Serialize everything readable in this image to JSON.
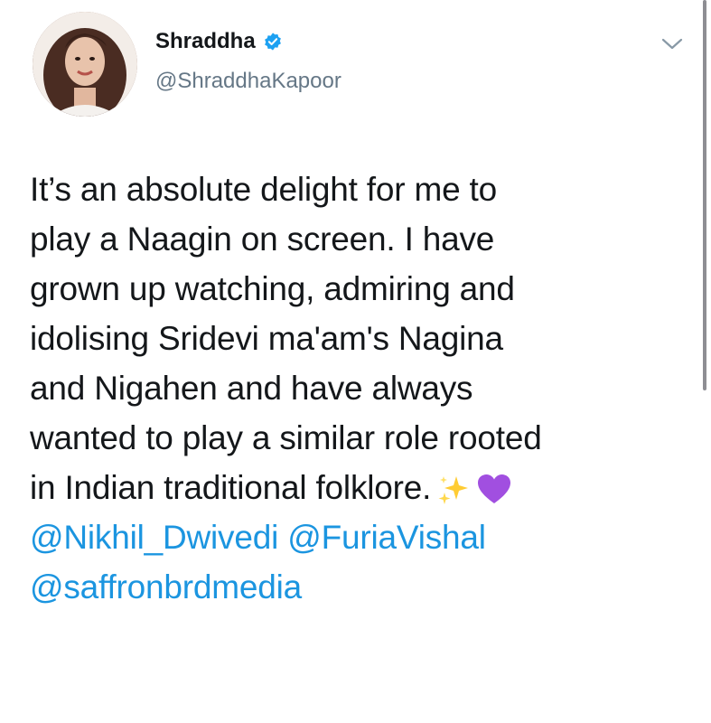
{
  "user": {
    "name": "Shraddha",
    "handle": "@ShraddhaKapoor",
    "verified": true
  },
  "tweet": {
    "lines": [
      "It’s an absolute delight for me to",
      "play a Naagin on screen. I have",
      "grown up watching, admiring and",
      "idolising Sridevi ma'am's Nagina",
      "and Nigahen and have always",
      "wanted to play a similar role rooted",
      "in Indian traditional folklore."
    ],
    "emojis": [
      "sparkles-emoji",
      "purple-heart-emoji"
    ],
    "mentions": [
      "@Nikhil_Dwivedi",
      "@FuriaVishal",
      "@saffronbrdmedia"
    ]
  },
  "colors": {
    "text": "#14171a",
    "handle": "#657786",
    "link": "#1b95e0",
    "verified": "#1da1f2"
  }
}
